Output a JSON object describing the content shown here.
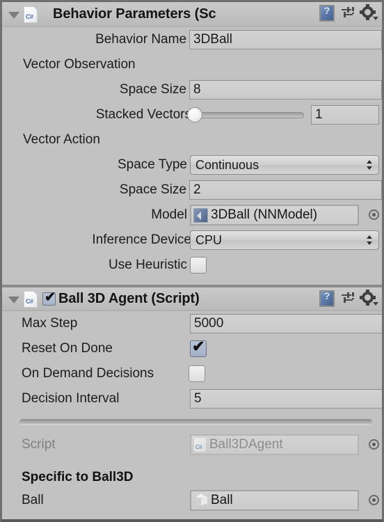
{
  "components": [
    {
      "title": "Behavior Parameters (Sc",
      "icon": "csharp-script-icon",
      "foldout": "expanded",
      "rows": [
        {
          "label": "Behavior Name",
          "type": "text",
          "value": "3DBall"
        },
        {
          "label": "Vector Observation",
          "type": "group"
        },
        {
          "label": "Space Size",
          "type": "text",
          "value": "8"
        },
        {
          "label": "Stacked Vectors",
          "type": "slider",
          "value": "1"
        },
        {
          "label": "Vector Action",
          "type": "group"
        },
        {
          "label": "Space Type",
          "type": "dropdown",
          "value": "Continuous"
        },
        {
          "label": "Space Size",
          "type": "text",
          "value": "2"
        },
        {
          "label": "Model",
          "type": "object",
          "value": "3DBall (NNModel)",
          "icon": "unity-asset-icon"
        },
        {
          "label": "Inference Device",
          "type": "dropdown",
          "value": "CPU"
        },
        {
          "label": "Use Heuristic",
          "type": "checkbox",
          "checked": false
        }
      ]
    },
    {
      "title": "Ball 3D Agent (Script)",
      "icon": "csharp-script-icon",
      "enabled": true,
      "foldout": "expanded",
      "rows": [
        {
          "label": "Max Step",
          "type": "text",
          "value": "5000"
        },
        {
          "label": "Reset On Done",
          "type": "checkbox",
          "checked": true
        },
        {
          "label": "On Demand Decisions",
          "type": "checkbox",
          "checked": false
        },
        {
          "label": "Decision Interval",
          "type": "text",
          "value": "5"
        },
        {
          "label": "Script",
          "type": "object",
          "value": "Ball3DAgent",
          "icon": "csharp-asset-icon",
          "disabled": true
        },
        {
          "label": "Specific to Ball3D",
          "type": "heading"
        },
        {
          "label": "Ball",
          "type": "object",
          "value": "Ball",
          "icon": "gameobject-cube-icon"
        }
      ]
    }
  ],
  "header_icons": {
    "help": "help-book-icon",
    "preset": "preset-sliders-icon",
    "settings": "gear-icon"
  },
  "colors": {
    "panel_bg": "#c2c2c2",
    "header_bg": "#c8c8c8",
    "field_bg": "#cdcdcd",
    "checkbox_checked": "#aab6cb",
    "accent_blue": "#4a6fa5",
    "text": "#1b1b1b",
    "text_disabled": "#8d8d8d",
    "border": "#8c8c8c"
  }
}
